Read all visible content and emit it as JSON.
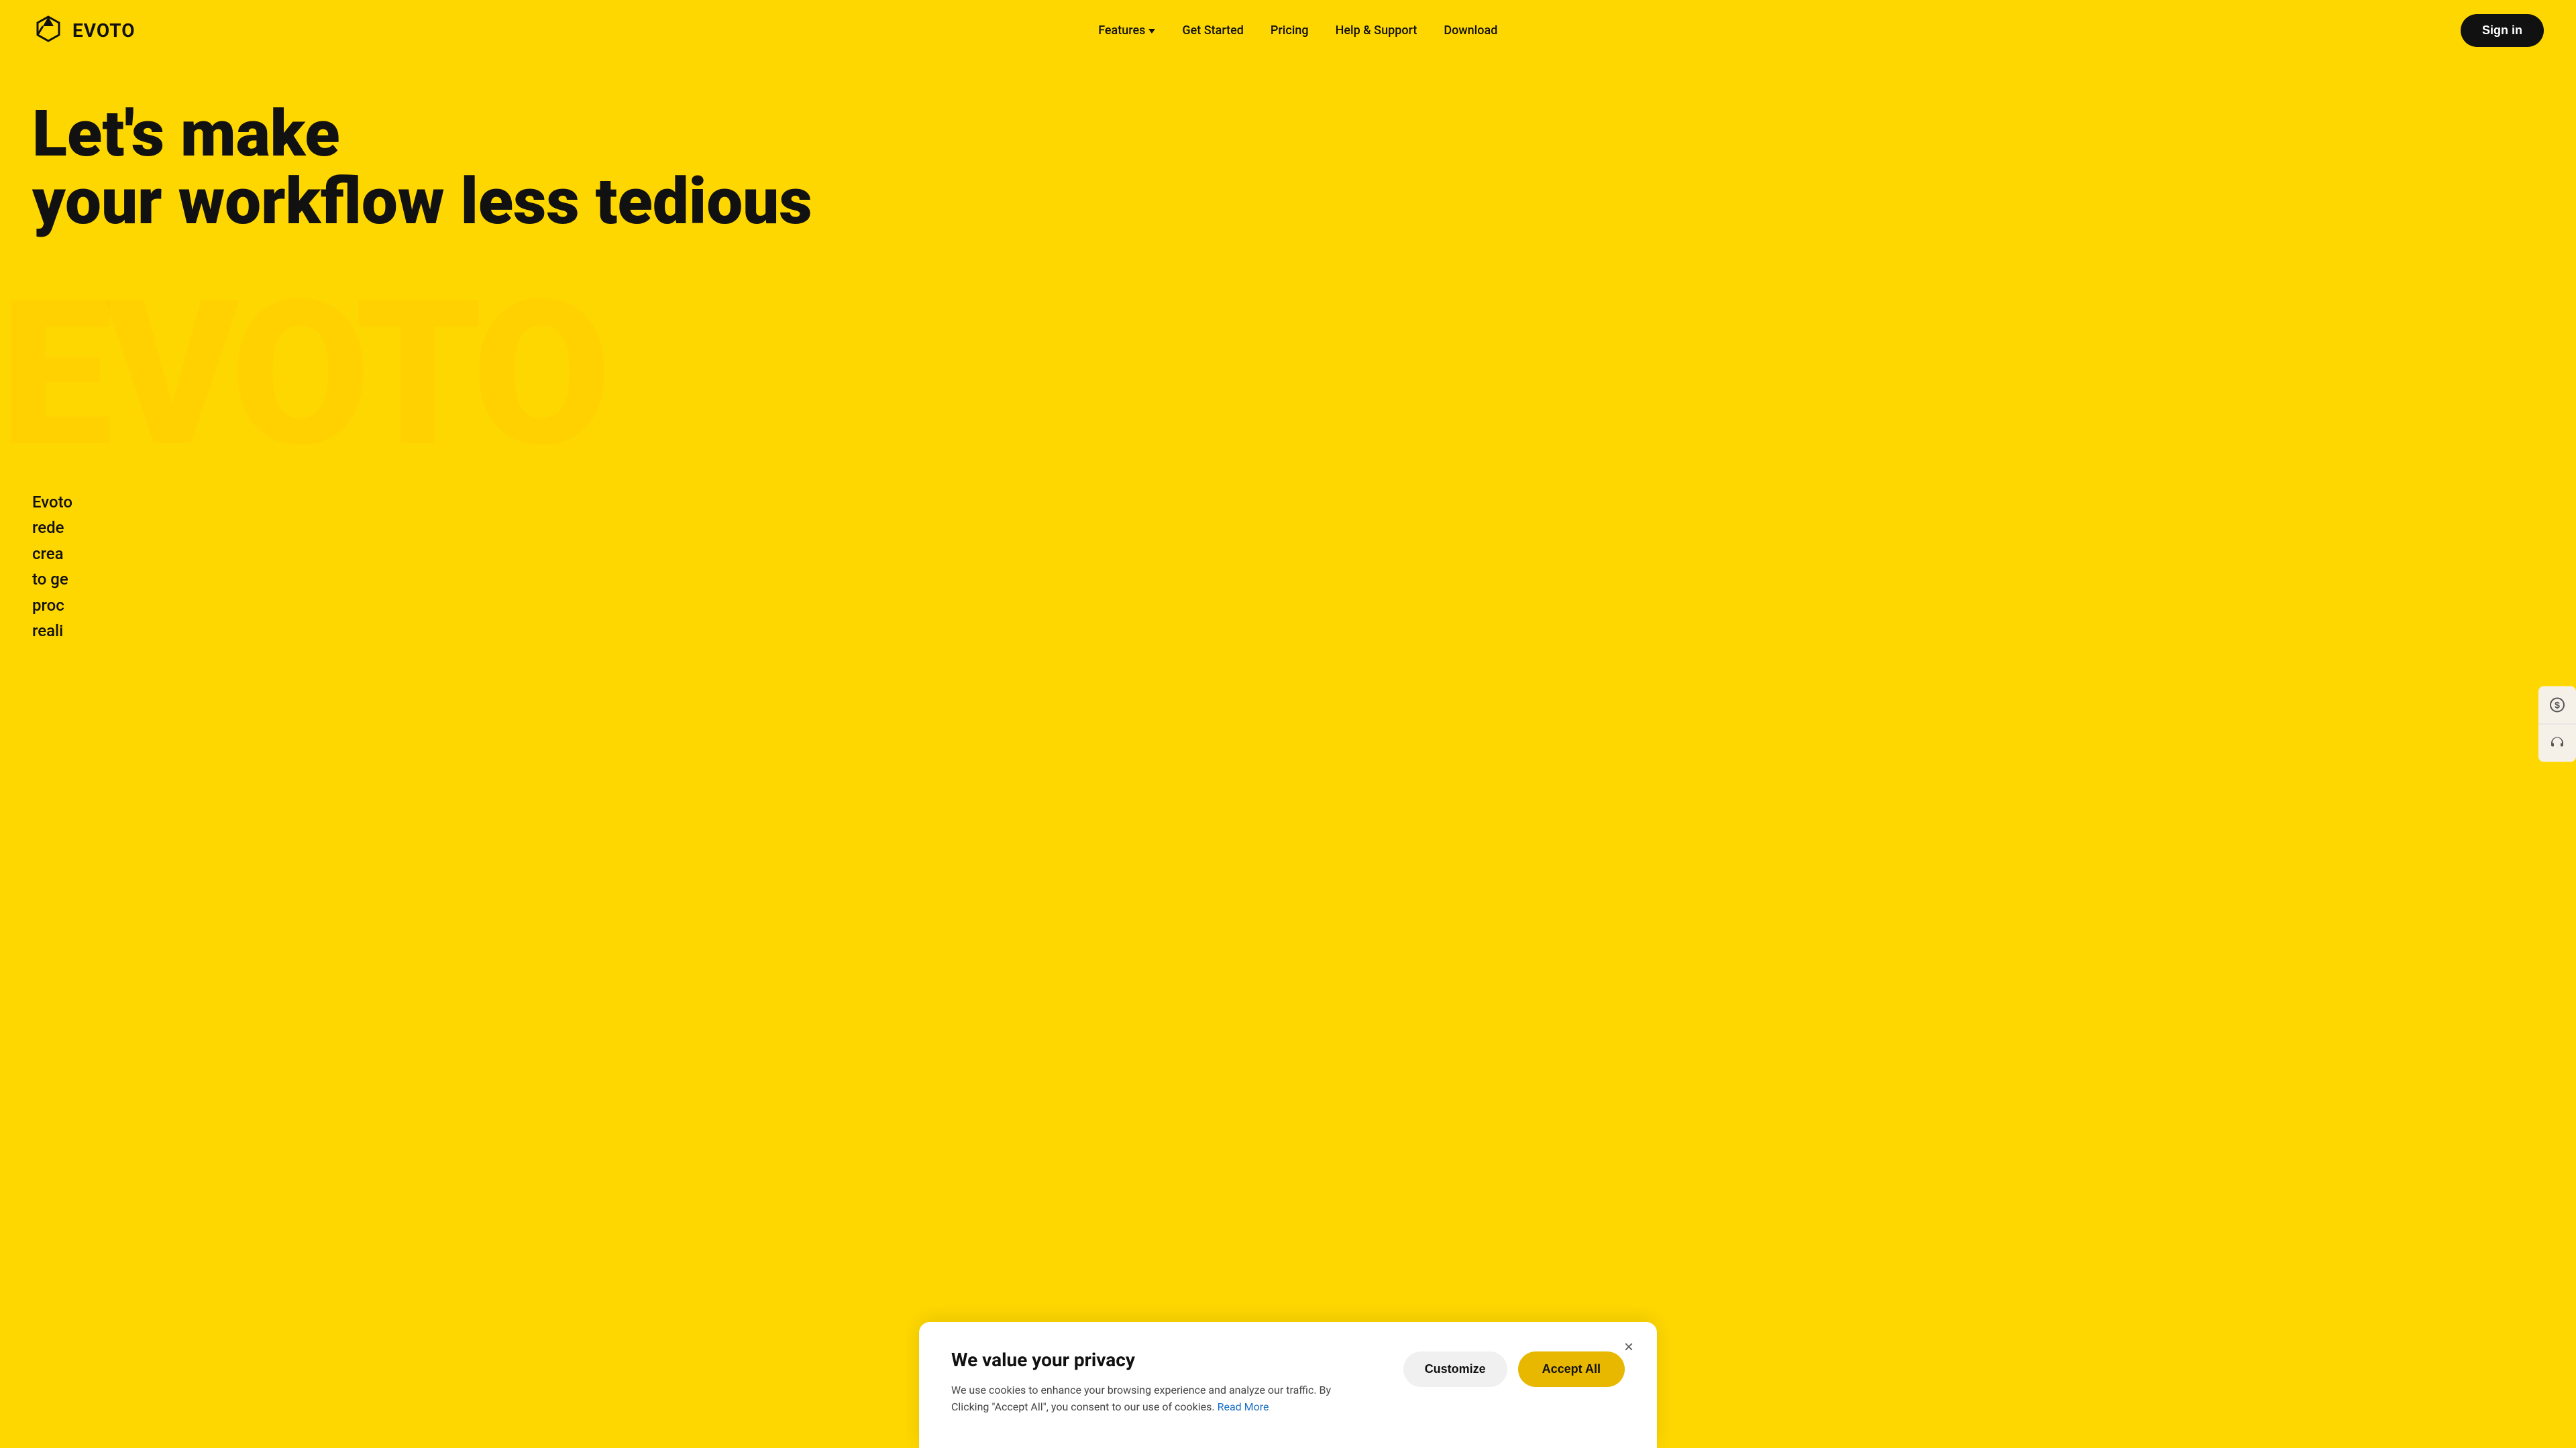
{
  "brand": {
    "name": "EVOTO",
    "logo_alt": "Evoto Logo"
  },
  "nav": {
    "features_label": "Features",
    "get_started_label": "Get Started",
    "pricing_label": "Pricing",
    "help_label": "Help & Support",
    "download_label": "Download",
    "signin_label": "Sign in"
  },
  "hero": {
    "title_line1": "Let's make",
    "title_line2": "your workflow  less tedious",
    "watermark_text": "EVOTO",
    "body_text_partial": "Evoto\nrede\ncrea\nto ge\nproc\nreali"
  },
  "side_buttons": {
    "pricing_icon": "$",
    "support_icon": "headset"
  },
  "cookie": {
    "title": "We value your privacy",
    "description": "We use cookies to enhance your browsing experience and analyze our traffic. By Clicking \"Accept All\", you consent to our use of cookies.",
    "read_more_label": "Read More",
    "customize_label": "Customize",
    "accept_label": "Accept All",
    "close_label": "×"
  }
}
